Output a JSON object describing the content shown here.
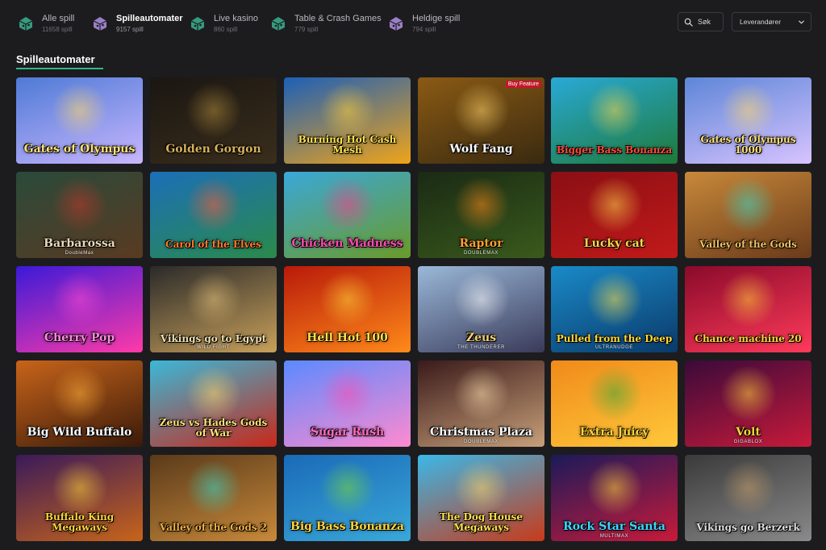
{
  "categories": [
    {
      "label": "Alle spill",
      "count": "11658 spill",
      "active": false,
      "color": "#3aa889"
    },
    {
      "label": "Spilleautomater",
      "count": "9157 spill",
      "active": true,
      "color": "#a98bd8"
    },
    {
      "label": "Live kasino",
      "count": "860 spill",
      "active": false,
      "color": "#3aa889"
    },
    {
      "label": "Table & Crash Games",
      "count": "779 spill",
      "active": false,
      "color": "#3aa889"
    },
    {
      "label": "Heldige spill",
      "count": "794 spill",
      "active": false,
      "color": "#a98bd8"
    }
  ],
  "search": {
    "label": "Søk",
    "icon": "search-icon"
  },
  "provider": {
    "label": "Leverandører",
    "icon": "chevron-down-icon"
  },
  "section": {
    "title": "Spilleautomater",
    "accent": "#2fb98a"
  },
  "games": [
    {
      "name": "Gates of Olympus",
      "sub": "",
      "tag": "",
      "bg1": "#4e7ad6",
      "bg2": "#c9b6ff",
      "glow": "#ffd86a",
      "fg": "#ffe27a"
    },
    {
      "name": "Golden Gorgon",
      "sub": "",
      "tag": "",
      "bg1": "#1a1612",
      "bg2": "#3a2e1c",
      "glow": "#b08a3a",
      "fg": "#d8b25a"
    },
    {
      "name": "Burning Hot Cash Mesh",
      "sub": "",
      "tag": "",
      "bg1": "#1c5fb8",
      "bg2": "#f0a418",
      "glow": "#ffcf3a",
      "fg": "#ffe14a"
    },
    {
      "name": "Wolf Fang",
      "sub": "",
      "tag": "Buy Feature",
      "bg1": "#8a5a14",
      "bg2": "#3a2a10",
      "glow": "#ffd36a",
      "fg": "#ffffff"
    },
    {
      "name": "Bigger Bass Bonanza",
      "sub": "",
      "tag": "",
      "bg1": "#29a9d6",
      "bg2": "#1e7a3a",
      "glow": "#f7d54a",
      "fg": "#ff4a3a"
    },
    {
      "name": "Gates of Olympus 1000",
      "sub": "",
      "tag": "",
      "bg1": "#5d86d8",
      "bg2": "#d8c3ff",
      "glow": "#ffd86a",
      "fg": "#ffe27a"
    },
    {
      "name": "Barbarossa",
      "sub": "DoubleMax",
      "tag": "",
      "bg1": "#2a4a3a",
      "bg2": "#5a3a22",
      "glow": "#c2382a",
      "fg": "#e8d9b8"
    },
    {
      "name": "Carol of the Elves",
      "sub": "",
      "tag": "",
      "bg1": "#1b6fb8",
      "bg2": "#2a8a4a",
      "glow": "#ff5a3a",
      "fg": "#ff7a2a"
    },
    {
      "name": "Chicken Madness",
      "sub": "",
      "tag": "",
      "bg1": "#3aa8d8",
      "bg2": "#6a9a2a",
      "glow": "#ff3a8a",
      "fg": "#ff4ab0"
    },
    {
      "name": "Raptor",
      "sub": "DOUBLEMAX",
      "tag": "",
      "bg1": "#1a2a14",
      "bg2": "#3a5a1c",
      "glow": "#ff8a1a",
      "fg": "#ffa030"
    },
    {
      "name": "Lucky cat",
      "sub": "",
      "tag": "",
      "bg1": "#8a0f14",
      "bg2": "#c21a1a",
      "glow": "#ffd84a",
      "fg": "#ffd84a"
    },
    {
      "name": "Valley of the Gods",
      "sub": "",
      "tag": "",
      "bg1": "#c8893a",
      "bg2": "#6a3a1a",
      "glow": "#3ad8c8",
      "fg": "#f0c060"
    },
    {
      "name": "Cherry Pop",
      "sub": "",
      "tag": "",
      "bg1": "#3a1ad8",
      "bg2": "#ff3aa8",
      "glow": "#ff4ad0",
      "fg": "#ff8ae0"
    },
    {
      "name": "Vikings go to Egypt",
      "sub": "WILD FIGHT",
      "tag": "",
      "bg1": "#2a2a2a",
      "bg2": "#c8a05a",
      "glow": "#e6c27a",
      "fg": "#f0e0b0"
    },
    {
      "name": "Hell Hot 100",
      "sub": "",
      "tag": "",
      "bg1": "#b81a0a",
      "bg2": "#ff8a1a",
      "glow": "#ffd43a",
      "fg": "#ffe04a"
    },
    {
      "name": "Zeus",
      "sub": "THE THUNDERER",
      "tag": "",
      "bg1": "#9ab8d8",
      "bg2": "#3a3a5a",
      "glow": "#ffffff",
      "fg": "#f0d070"
    },
    {
      "name": "Pulled from the Deep",
      "sub": "ULTRANUDGE",
      "tag": "",
      "bg1": "#1a8ac8",
      "bg2": "#0a3a6a",
      "glow": "#ffe04a",
      "fg": "#ffd83a"
    },
    {
      "name": "Chance machine 20",
      "sub": "",
      "tag": "",
      "bg1": "#8a0a2a",
      "bg2": "#ff3a5a",
      "glow": "#ffd03a",
      "fg": "#ffd43a"
    },
    {
      "name": "Big Wild Buffalo",
      "sub": "",
      "tag": "",
      "bg1": "#c8641a",
      "bg2": "#3a1a0a",
      "glow": "#ffb03a",
      "fg": "#ffffff"
    },
    {
      "name": "Zeus vs Hades Gods of War",
      "sub": "",
      "tag": "",
      "bg1": "#3ab8d8",
      "bg2": "#c8281a",
      "glow": "#ffd86a",
      "fg": "#ffe27a"
    },
    {
      "name": "Sugar Rush",
      "sub": "",
      "tag": "",
      "bg1": "#5a8aff",
      "bg2": "#ff8ad0",
      "glow": "#ff4ab0",
      "fg": "#ff6ac0"
    },
    {
      "name": "Christmas Plaza",
      "sub": "DOUBLEMAX",
      "tag": "",
      "bg1": "#3a1a1a",
      "bg2": "#c8a07a",
      "glow": "#ffe0b0",
      "fg": "#ffffff"
    },
    {
      "name": "Extra Juicy",
      "sub": "",
      "tag": "",
      "bg1": "#f08a1a",
      "bg2": "#ffc83a",
      "glow": "#3aa83a",
      "fg": "#ffd43a"
    },
    {
      "name": "Volt",
      "sub": "GIGABLOX",
      "tag": "",
      "bg1": "#3a0a3a",
      "bg2": "#c81a3a",
      "glow": "#ffd43a",
      "fg": "#ffd43a"
    },
    {
      "name": "Buffalo King Megaways",
      "sub": "",
      "tag": "",
      "bg1": "#3a1a5a",
      "bg2": "#c8641a",
      "glow": "#ffd43a",
      "fg": "#ffd43a"
    },
    {
      "name": "Valley of the Gods 2",
      "sub": "",
      "tag": "",
      "bg1": "#5a3a1a",
      "bg2": "#c8893a",
      "glow": "#3ad8c8",
      "fg": "#f0b040"
    },
    {
      "name": "Big Bass Bonanza",
      "sub": "",
      "tag": "",
      "bg1": "#1a6ab8",
      "bg2": "#3aa8d8",
      "glow": "#7ad83a",
      "fg": "#ffd43a"
    },
    {
      "name": "The Dog House Megaways",
      "sub": "",
      "tag": "",
      "bg1": "#3ab8e8",
      "bg2": "#c83a1a",
      "glow": "#ffd86a",
      "fg": "#ffe04a"
    },
    {
      "name": "Rock Star Santa",
      "sub": "MULTIMAX",
      "tag": "",
      "bg1": "#1a1a5a",
      "bg2": "#c81a3a",
      "glow": "#ffd43a",
      "fg": "#3ad8ff"
    },
    {
      "name": "Vikings go Berzerk",
      "sub": "",
      "tag": "",
      "bg1": "#3a3a3a",
      "bg2": "#8a8a8a",
      "glow": "#c8a06a",
      "fg": "#e0e0e0"
    }
  ]
}
